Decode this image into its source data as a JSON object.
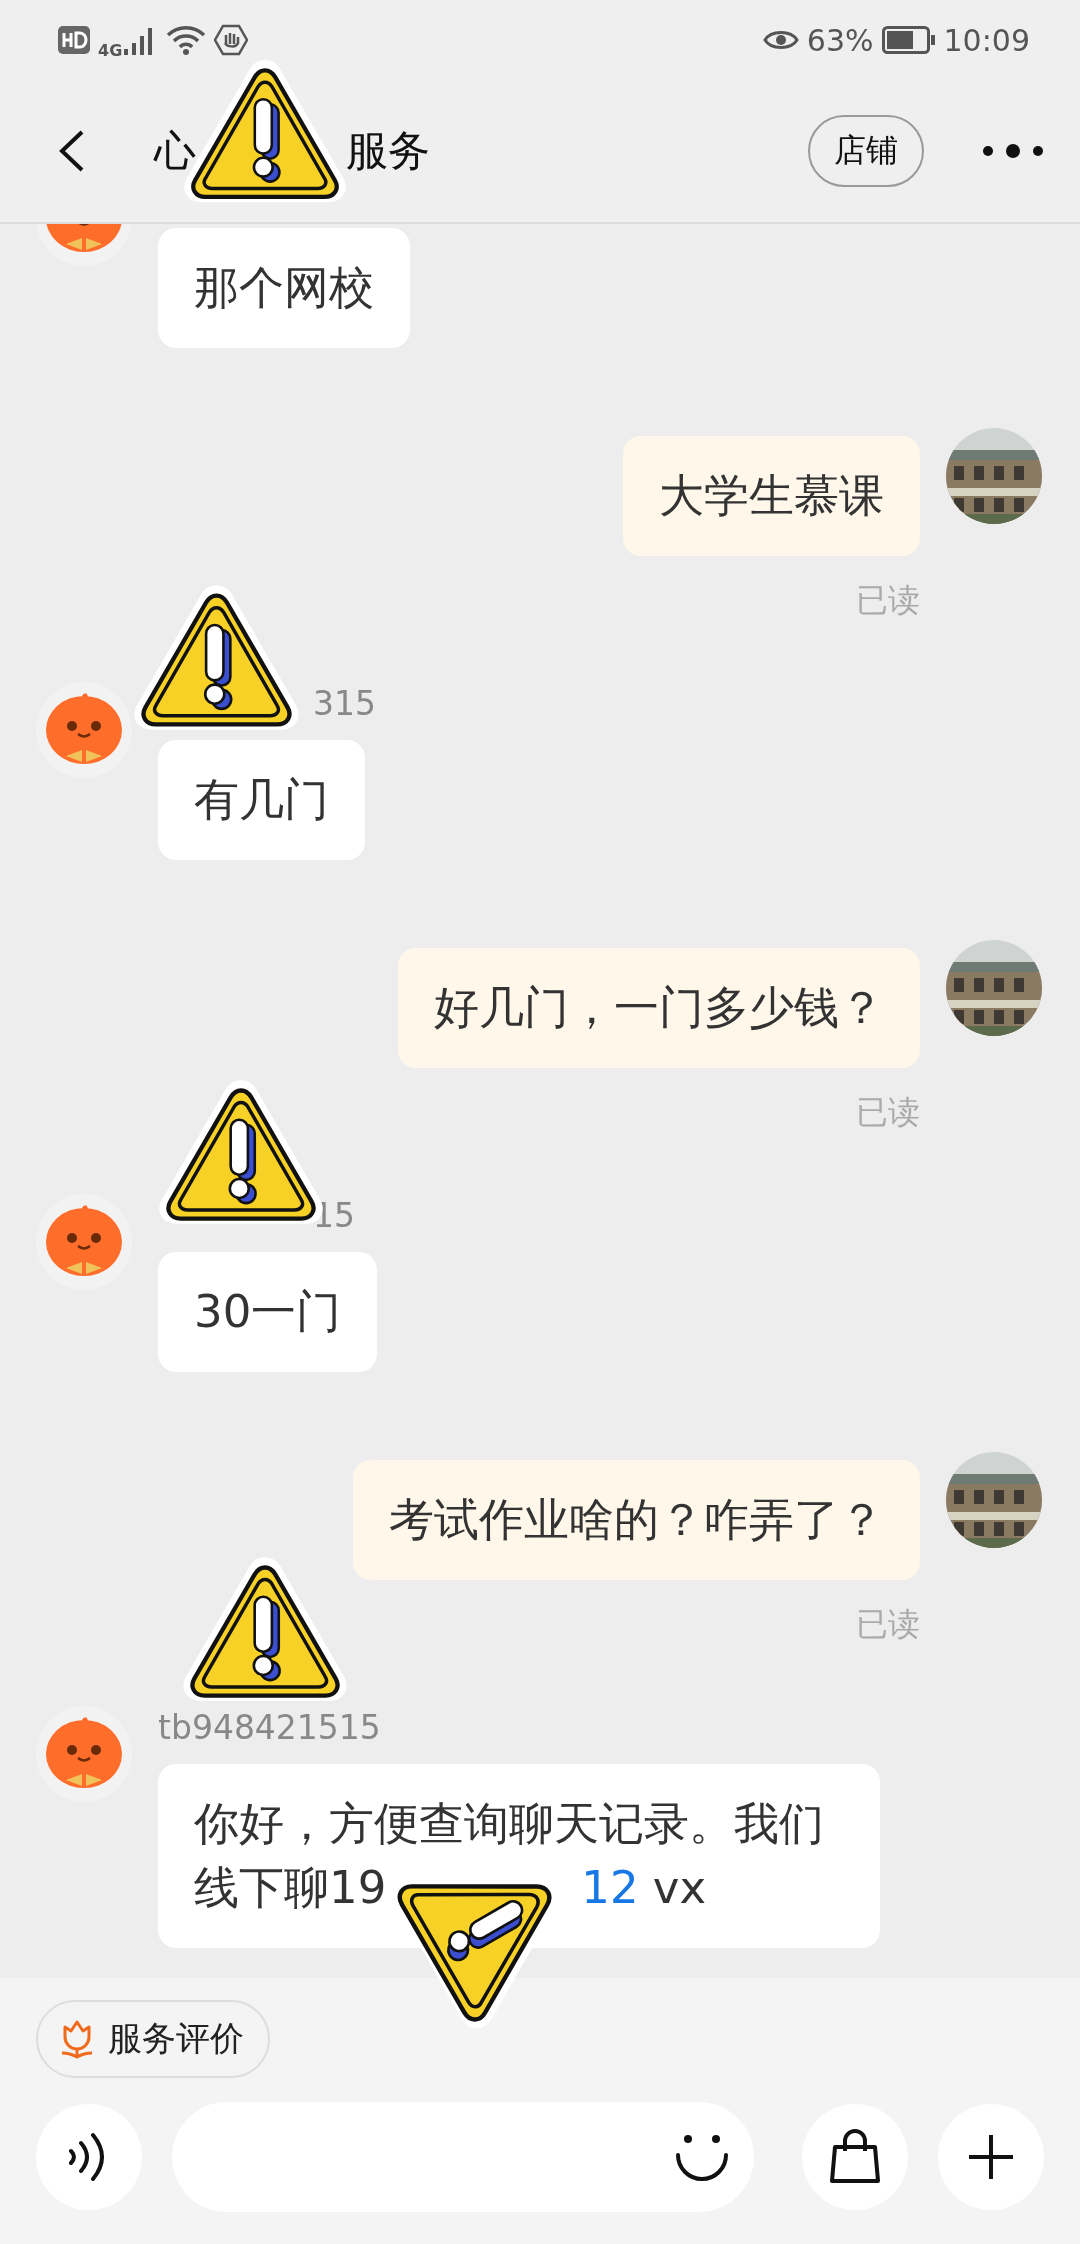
{
  "status_bar": {
    "network": "4G",
    "battery": "63%",
    "time": "10:09"
  },
  "header": {
    "title": [
      {
        "kind": "text",
        "text": "心"
      },
      {
        "kind": "covered"
      },
      {
        "kind": "text",
        "text": "服务"
      }
    ],
    "store_button": "店铺"
  },
  "messages": [
    {
      "kind": "received",
      "segments": [
        {
          "kind": "text",
          "text": "那个网校"
        }
      ]
    },
    {
      "kind": "sent",
      "segments": [
        {
          "kind": "text",
          "text": "大学生慕课"
        }
      ],
      "receipt": "已读"
    },
    {
      "kind": "received",
      "name": [
        {
          "kind": "covered"
        },
        {
          "kind": "text",
          "text": "315"
        }
      ],
      "segments": [
        {
          "kind": "text",
          "text": "有几门"
        }
      ]
    },
    {
      "kind": "sent",
      "segments": [
        {
          "kind": "text",
          "text": "好几门，一门多少钱？"
        }
      ],
      "receipt": "已读"
    },
    {
      "kind": "received",
      "name": [
        {
          "kind": "covered"
        },
        {
          "kind": "text",
          "text": "15"
        }
      ],
      "segments": [
        {
          "kind": "text",
          "text": "30一门"
        }
      ]
    },
    {
      "kind": "sent",
      "segments": [
        {
          "kind": "text",
          "text": "考试作业啥的？咋弄了？"
        }
      ],
      "receipt": "已读"
    },
    {
      "kind": "received",
      "name": [
        {
          "kind": "text",
          "text": "tb948421515"
        }
      ],
      "segments": [
        {
          "kind": "text",
          "text": "你好，方便查询聊天记录。我们线下聊19"
        },
        {
          "kind": "covered"
        },
        {
          "kind": "link",
          "text": "12"
        },
        {
          "kind": "text",
          "text": " vx"
        }
      ]
    }
  ],
  "bottom": {
    "review_chip": "服务评价"
  }
}
